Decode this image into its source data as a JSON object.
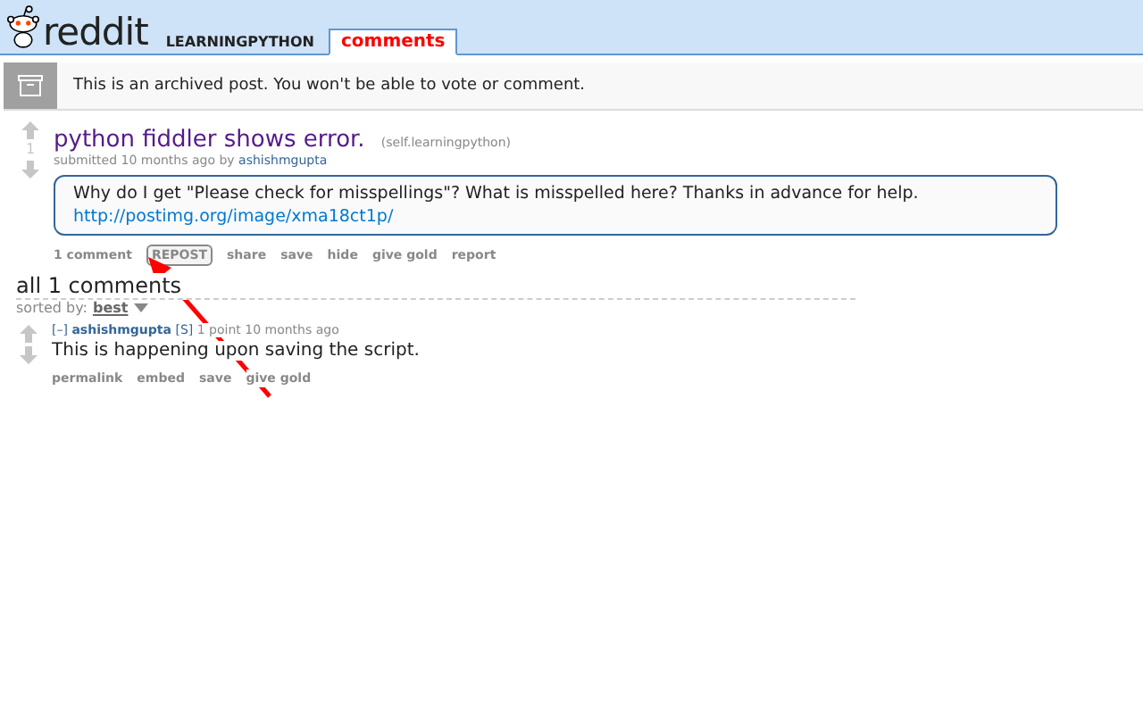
{
  "header": {
    "logo": "reddit",
    "subreddit": "LEARNINGPYTHON",
    "tabs": [
      {
        "label": "comments",
        "selected": true
      }
    ]
  },
  "notice": {
    "text": "This is an archived post. You won't be able to vote or comment."
  },
  "post": {
    "score": "1",
    "title": "python fiddler shows error.",
    "domain": "(self.learningpython)",
    "tagline": "submitted 10 months ago by",
    "author": "ashishmgupta",
    "body": "Why do I get \"Please check for misspellings\"? What is misspelled here? Thanks in advance for help.",
    "link": "http://postimg.org/image/xma18ct1p/",
    "actions": [
      {
        "label": "1 comment",
        "highlighted": false
      },
      {
        "label": "REPOST",
        "highlighted": true
      },
      {
        "label": "share",
        "highlighted": false
      },
      {
        "label": "save",
        "highlighted": false
      },
      {
        "label": "hide",
        "highlighted": false
      },
      {
        "label": "give gold",
        "highlighted": false
      },
      {
        "label": "report",
        "highlighted": false
      }
    ]
  },
  "comments_title": "all 1 comments",
  "sort": {
    "label": "sorted by:",
    "value": "best"
  },
  "comments": [
    {
      "toggle": "[–]",
      "author": "ashishmgupta",
      "flair": "[S]",
      "meta": "1 point 10 months ago",
      "body": "This is happening upon saving the script.",
      "actions": [
        "permalink",
        "embed",
        "save",
        "give gold"
      ]
    }
  ]
}
